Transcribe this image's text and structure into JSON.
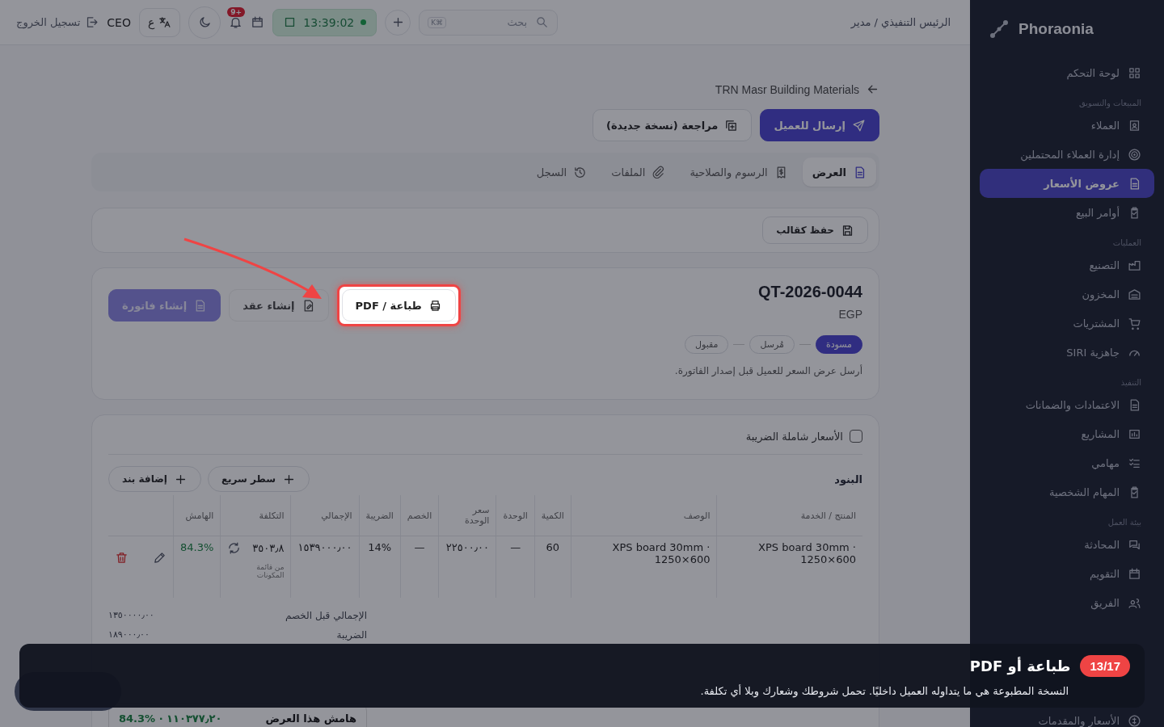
{
  "sidebar": {
    "brand": "Phoraonia",
    "sections": [
      {
        "items": [
          {
            "label": "لوحة التحكم",
            "selected": false
          }
        ]
      },
      {
        "label": "المبيعات والتسويق",
        "items": [
          {
            "label": "العملاء",
            "selected": false
          },
          {
            "label": "إدارة العملاء المحتملين",
            "selected": false
          },
          {
            "label": "عروض الأسعار",
            "selected": true
          },
          {
            "label": "أوامر البيع",
            "selected": false
          }
        ]
      },
      {
        "label": "العمليات",
        "items": [
          {
            "label": "التصنيع",
            "selected": false
          },
          {
            "label": "المخزون",
            "selected": false
          },
          {
            "label": "المشتريات",
            "selected": false
          },
          {
            "label": "جاهزية SIRI",
            "selected": false
          }
        ]
      },
      {
        "label": "التنفيذ",
        "items": [
          {
            "label": "الاعتمادات والضمانات",
            "selected": false
          },
          {
            "label": "المشاريع",
            "selected": false
          },
          {
            "label": "مهامي",
            "selected": false
          },
          {
            "label": "المهام الشخصية",
            "selected": false
          }
        ]
      },
      {
        "label": "بيئة العمل",
        "items": [
          {
            "label": "المحادثة",
            "selected": false
          },
          {
            "label": "التقويم",
            "selected": false
          },
          {
            "label": "الفريق",
            "selected": false
          },
          {
            "label": "الأسعار والمقدمات",
            "selected": false
          }
        ]
      }
    ]
  },
  "topbar": {
    "user_role": "الرئيس التنفيذي / مدير",
    "search": {
      "placeholder": "بحث",
      "shortcut": "K⌘"
    },
    "clock": "13:39:02",
    "notifications": "+9",
    "language": "ع",
    "user": "CEO",
    "logout": "تسجيل الخروج"
  },
  "breadcrumb": "TRN Masr Building Materials",
  "actions": [
    {
      "label": "إرسال للعميل",
      "kind": "primary"
    },
    {
      "label": "مراجعة (نسخة جديدة)",
      "kind": "secondary"
    }
  ],
  "tabs": [
    {
      "label": "العرض",
      "selected": true
    },
    {
      "label": "الرسوم والصلاحية",
      "selected": false
    },
    {
      "label": "الملفات",
      "selected": false
    },
    {
      "label": "السجل",
      "selected": false
    }
  ],
  "save_template": "حفظ كقالب",
  "quote": {
    "number": "QT-2026-0044",
    "currency": "EGP",
    "steps": [
      {
        "label": "مسودة",
        "selected": true
      },
      {
        "label": "مُرسل",
        "selected": false
      },
      {
        "label": "مقبول",
        "selected": false
      }
    ],
    "hint": "أرسل عرض السعر للعميل قبل إصدار الفاتورة.",
    "buttons": [
      {
        "label": "طباعة / PDF",
        "kind": "print",
        "disabled": false,
        "highlighted": true
      },
      {
        "label": "إنشاء عقد",
        "kind": "contract",
        "disabled": false,
        "highlighted": false
      },
      {
        "label": "إنشاء فاتورة",
        "kind": "invoice",
        "disabled": true,
        "highlighted": false
      }
    ]
  },
  "items": {
    "tax_inclusive": {
      "label": "الأسعار شاملة الضريبة",
      "checked": false
    },
    "title": "البنود",
    "buttons": [
      "سطر سريع",
      "إضافة بند"
    ],
    "columns": [
      "المنتج / الخدمة",
      "الوصف",
      "الكمية",
      "الوحدة",
      "سعر الوحدة",
      "الخصم",
      "الضريبة",
      "الإجمالي",
      "التكلفة",
      "الهامش"
    ],
    "rows": [
      {
        "cells": [
          "XPS board 30mm · 1250×600",
          "XPS board 30mm · 1250×600",
          "60",
          "—",
          "٢٢٥٠٠٫٠٠",
          "—",
          "14%",
          "١٥٣٩٠٠٠٫٠٠",
          "٣٥٠٣٫٨",
          "84.3%"
        ],
        "cost_source": "من قائمة المكونات"
      }
    ],
    "totals": [
      {
        "label": "الإجمالي قبل الخصم",
        "value": "١٣٥٠٠٠٠٫٠٠"
      },
      {
        "label": "الضريبة",
        "value": "١٨٩٠٠٠٫٠٠"
      }
    ],
    "margin": {
      "label": "هامش هذا العرض",
      "value": "84.3% · ١١٠٣٧٧٫٢٠"
    }
  },
  "tour": {
    "step": "13/17",
    "title": "طباعة أو PDF",
    "text": "النسخة المطبوعة هي ما يتداوله العميل داخليًا. تحمل شروطك وشعارك وبلا أي تكلفة."
  }
}
